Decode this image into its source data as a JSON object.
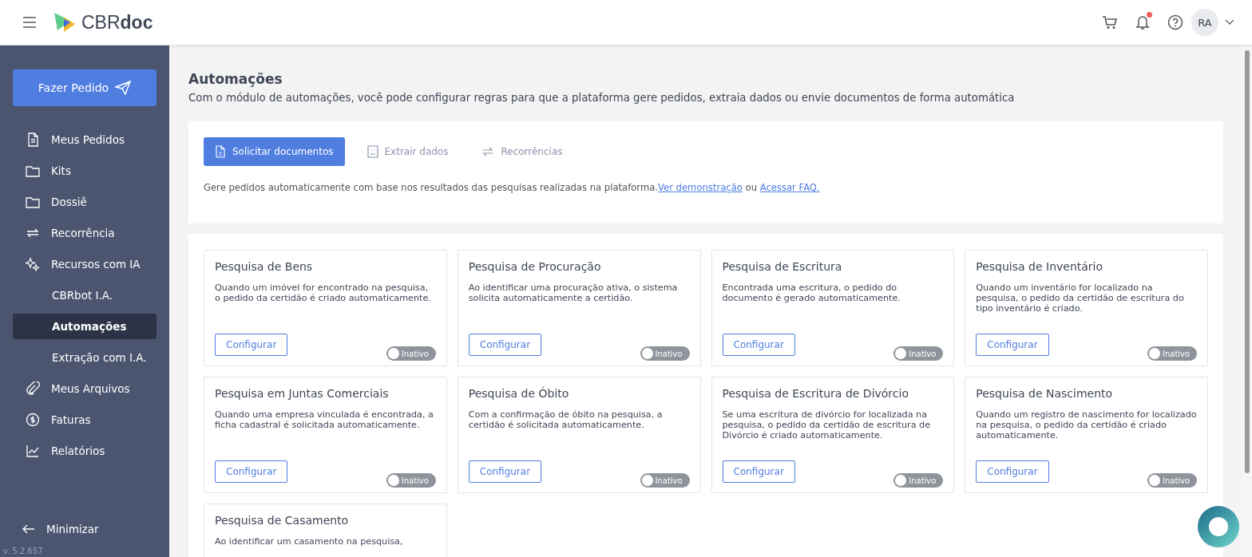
{
  "header": {
    "logo": {
      "part_1": "CBR",
      "part_2": "doc"
    },
    "avatar": "RA",
    "notification_dot": true
  },
  "sidebar": {
    "primary_button": "Fazer Pedido",
    "items": [
      {
        "label": "Meus Pedidos",
        "selected": false
      },
      {
        "label": "Kits",
        "selected": false
      },
      {
        "label": "Dossiê",
        "selected": false
      },
      {
        "label": "Recorrência",
        "selected": false
      },
      {
        "label": "Recursos com IA",
        "selected": false,
        "children": [
          {
            "label": "CBRbot I.A.",
            "selected": false
          },
          {
            "label": "Automações",
            "selected": true
          },
          {
            "label": "Extração com I.A.",
            "selected": false
          }
        ]
      },
      {
        "label": "Meus Arquivos",
        "selected": false
      },
      {
        "label": "Faturas",
        "selected": false
      },
      {
        "label": "Relatórios",
        "selected": false
      }
    ],
    "minimize": "Minimizar",
    "version": "v. 5.2.657"
  },
  "page": {
    "title": "Automações",
    "subtitle": "Com o módulo de automações, você pode configurar regras para que a plataforma gere pedidos, extraia dados ou envie documentos de forma automática"
  },
  "tabs": [
    {
      "label": "Solicitar documentos",
      "selected": true
    },
    {
      "label": "Extrair dados",
      "selected": false
    },
    {
      "label": "Recorrências",
      "selected": false
    }
  ],
  "tab_description": {
    "text": "Gere pedidos automaticamente com base nos resultados das pesquisas realizadas na plataforma.",
    "link_1": "Ver demonstração",
    "joiner": "ou",
    "link_2": "Acessar FAQ."
  },
  "cards": [
    {
      "title": "Pesquisa de Bens",
      "description": "Quando um imóvel for encontrado na pesquisa, o pedido da certidão é criado automaticamente.",
      "button": "Configurar",
      "status": "Inativo",
      "on": false
    },
    {
      "title": "Pesquisa de Procuração",
      "description": "Ao identificar uma procuração ativa, o sistema solicita automaticamente a certidão.",
      "button": "Configurar",
      "status": "Inativo",
      "on": false
    },
    {
      "title": "Pesquisa de Escritura",
      "description": "Encontrada uma escritura, o pedido do documento é gerado automaticamente.",
      "button": "Configurar",
      "status": "Inativo",
      "on": false
    },
    {
      "title": "Pesquisa de Inventário",
      "description": "Quando um inventário for localizado na pesquisa, o pedido da certidão de escritura do tipo inventário é criado.",
      "button": "Configurar",
      "status": "Inativo",
      "on": false
    },
    {
      "title": "Pesquisa em Juntas Comerciais",
      "description": "Quando uma empresa vinculada é encontrada, a ficha cadastral é solicitada automaticamente.",
      "button": "Configurar",
      "status": "Inativo",
      "on": false
    },
    {
      "title": "Pesquisa de Óbito",
      "description": "Com a confirmação de óbito na pesquisa, a certidão é solicitada automaticamente.",
      "button": "Configurar",
      "status": "Inativo",
      "on": false
    },
    {
      "title": "Pesquisa de Escritura de Divórcio",
      "description": "Se uma escritura de divórcio for localizada na pesquisa, o pedido da certidão de escritura de Divórcio é criado automaticamente.",
      "button": "Configurar",
      "status": "Inativo",
      "on": false
    },
    {
      "title": "Pesquisa de Nascimento",
      "description": "Quando um registro de nascimento for localizado na pesquisa, o pedido da certidão é criado automaticamente.",
      "button": "Configurar",
      "status": "Inativo",
      "on": false
    },
    {
      "title": "Pesquisa de Casamento",
      "description": "Ao identificar um casamento na pesquisa,"
    }
  ]
}
